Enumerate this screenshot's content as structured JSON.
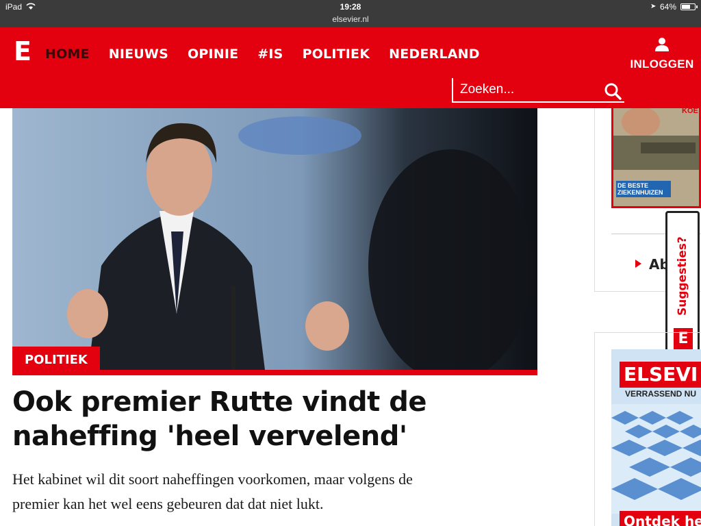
{
  "status_bar": {
    "device": "iPad",
    "time": "19:28",
    "url": "elsevier.nl",
    "battery": "64%",
    "battery_level": 0.64
  },
  "header": {
    "logo": "E",
    "nav": [
      {
        "label": "HOME",
        "active": true
      },
      {
        "label": "NIEUWS",
        "active": false
      },
      {
        "label": "OPINIE",
        "active": false
      },
      {
        "label": "#IS",
        "active": false
      },
      {
        "label": "POLITIEK",
        "active": false
      },
      {
        "label": "NEDERLAND",
        "active": false
      }
    ],
    "login_label": "INLOGGEN",
    "search_placeholder": "Zoeken...",
    "brand_color": "#e3000f"
  },
  "article": {
    "category": "POLITIEK",
    "headline_line1": "Ook premier Rutte vindt de",
    "headline_line2": "naheffing 'heel vervelend'",
    "lead_line1": "Het kabinet wil dit soort naheffingen voorkomen, maar volgens de",
    "lead_line2": "premier kan het wel eens gebeuren dat dat niet lukt."
  },
  "sidebar": {
    "magazine_title": "KOE",
    "magazine_band": "DE BESTE ZIEKENHUIZEN",
    "link_text": "Ab",
    "suggestions_label": "Suggesties?",
    "suggestions_badge": "E",
    "ad_brand": "ELSEVI",
    "ad_tagline": "VERRASSEND NU",
    "ad_cta": "Ontdek he"
  }
}
